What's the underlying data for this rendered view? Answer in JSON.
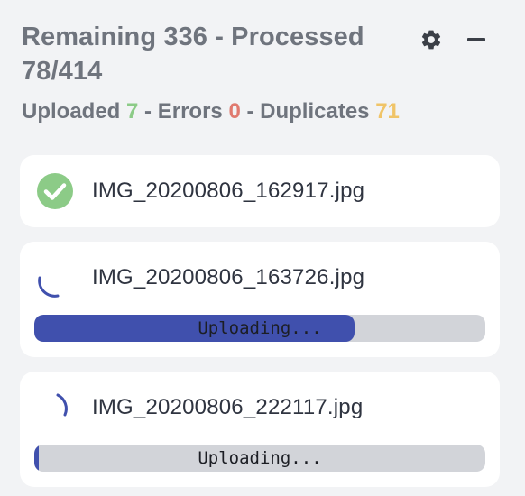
{
  "header": {
    "remaining_label": "Remaining",
    "remaining": "336",
    "processed_label": "Processed",
    "processed": "78/414",
    "uploaded_label": "Uploaded",
    "uploaded": "7",
    "errors_label": "Errors",
    "errors": "0",
    "duplicates_label": "Duplicates",
    "duplicates": "71",
    "separator": "-"
  },
  "controls": {
    "settings_icon": "gear-icon",
    "minimize_icon": "minus-icon"
  },
  "colors": {
    "success": "#8ccb87",
    "error": "#e07a6f",
    "warning": "#f0c468",
    "accent": "#4050ad",
    "track": "#d2d4d9"
  },
  "files": [
    {
      "name": "IMG_20200806_162917.jpg",
      "status": "done",
      "icon": "check-circle-icon"
    },
    {
      "name": "IMG_20200806_163726.jpg",
      "status": "uploading",
      "icon": "spinner-icon",
      "progress_label": "Uploading...",
      "progress": 0.71
    },
    {
      "name": "IMG_20200806_222117.jpg",
      "status": "uploading",
      "icon": "spinner-icon",
      "progress_label": "Uploading...",
      "progress": 0.01
    }
  ]
}
